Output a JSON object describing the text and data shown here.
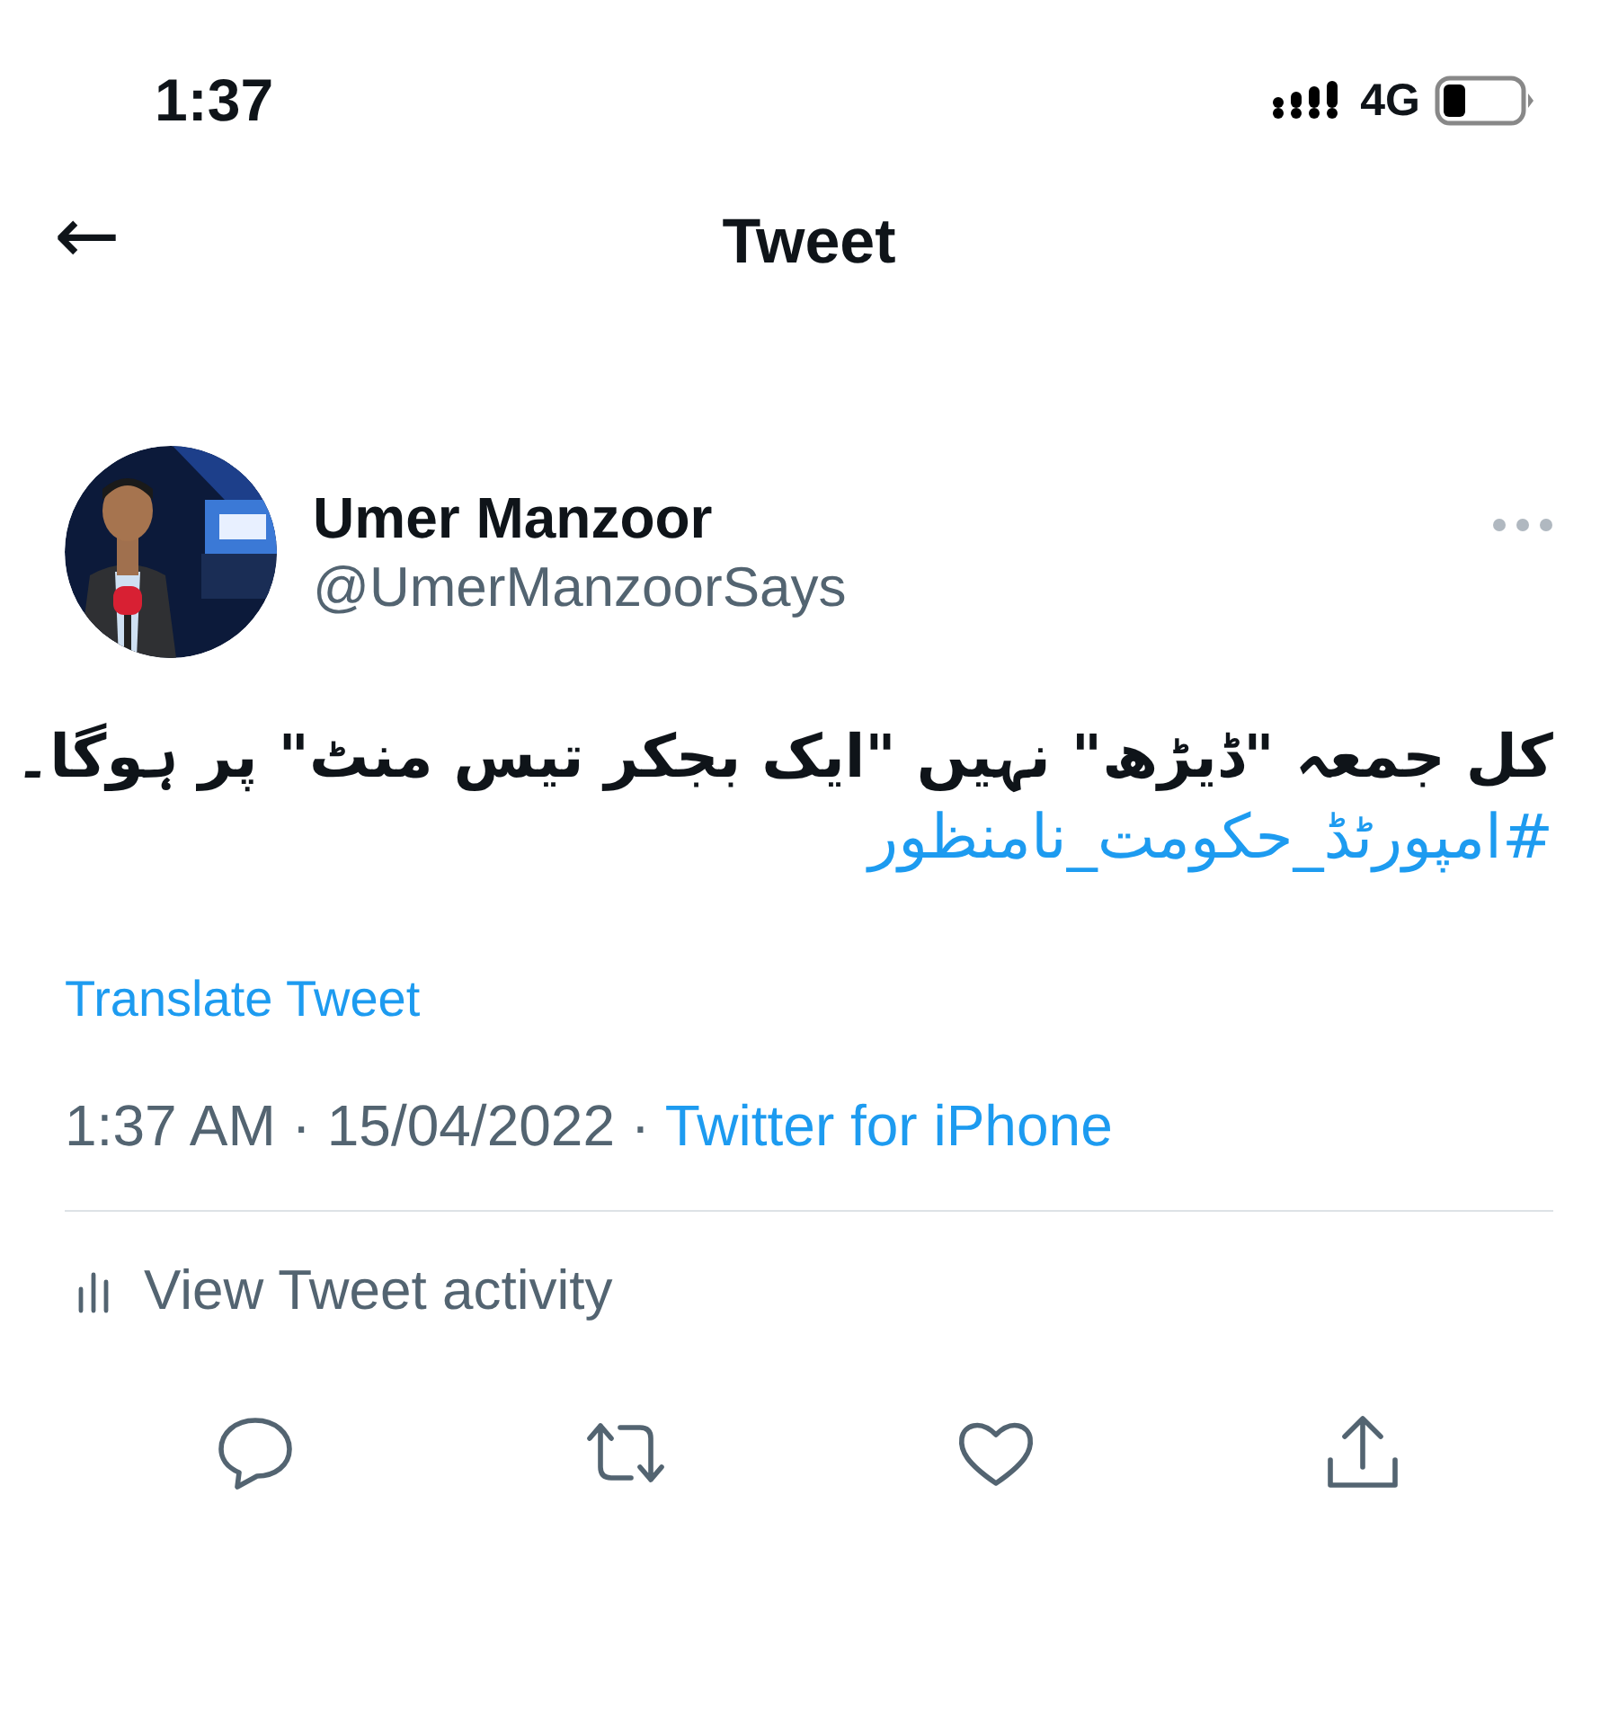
{
  "status_bar": {
    "time": "1:37",
    "network": "4G"
  },
  "header": {
    "back": "←",
    "title": "Tweet"
  },
  "tweet": {
    "author": {
      "name": "Umer Manzoor",
      "handle": "@UmerManzoorSays"
    },
    "text": "کل جمعہ \"ڈیڑھ\" نہیں \"ایک بجکر تیس منٹ\" پر ہوگا۔",
    "hashtag": "#امپورٹڈ_حکومت_نامنظور",
    "translate": "Translate Tweet",
    "time": "1:37 AM · 15/04/2022 · ",
    "source": "Twitter for iPhone",
    "activity": "View Tweet activity"
  }
}
